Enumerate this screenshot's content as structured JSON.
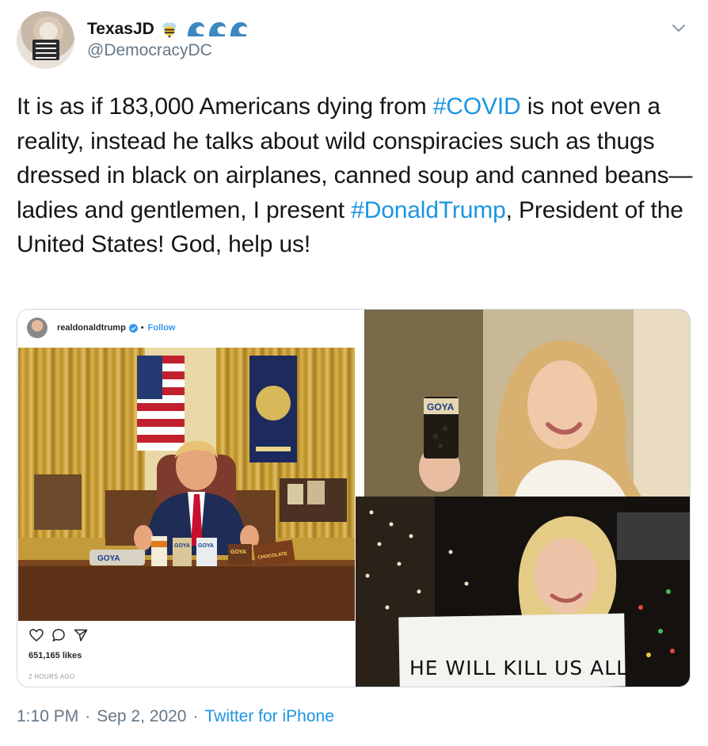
{
  "author": {
    "display_name": "TexasJD",
    "username": "@DemocracyDC"
  },
  "icons": {
    "bee": "bee-emoji-icon",
    "waves": [
      "wave-emoji-icon",
      "wave-emoji-icon",
      "wave-emoji-icon"
    ],
    "caret": "chevron-down-icon"
  },
  "tweet": {
    "text_1": "It is as if 183,000 Americans dying from ",
    "hashtag_1": "#COVID",
    "text_2": " is not even a reality, instead he talks about wild conspiracies such as thugs dressed in black on airplanes, canned soup and canned beans—ladies and gentlemen, I present ",
    "hashtag_2": "#DonaldTrump",
    "text_3": ", President of the United States! God, help us!"
  },
  "media": {
    "instagram": {
      "username": "realdonaldtrump",
      "follow": "Follow",
      "likes": "651,165 likes",
      "time": "2 HOURS AGO",
      "brand_labels": [
        "GOYA",
        "GOYA",
        "GOYA",
        "GOYA",
        "GOYA",
        "CHOCOLATE"
      ]
    },
    "photo_2": {
      "can_label": "GOYA"
    },
    "photo_3": {
      "sign_text": "HE WILL KILL US ALL"
    }
  },
  "footer": {
    "time": "1:10 PM",
    "sep1": "·",
    "date": "Sep 2, 2020",
    "sep2": "·",
    "source": "Twitter for iPhone"
  },
  "colors": {
    "hashtag": "#1b95e0",
    "muted": "#657786",
    "text": "#14171a"
  }
}
